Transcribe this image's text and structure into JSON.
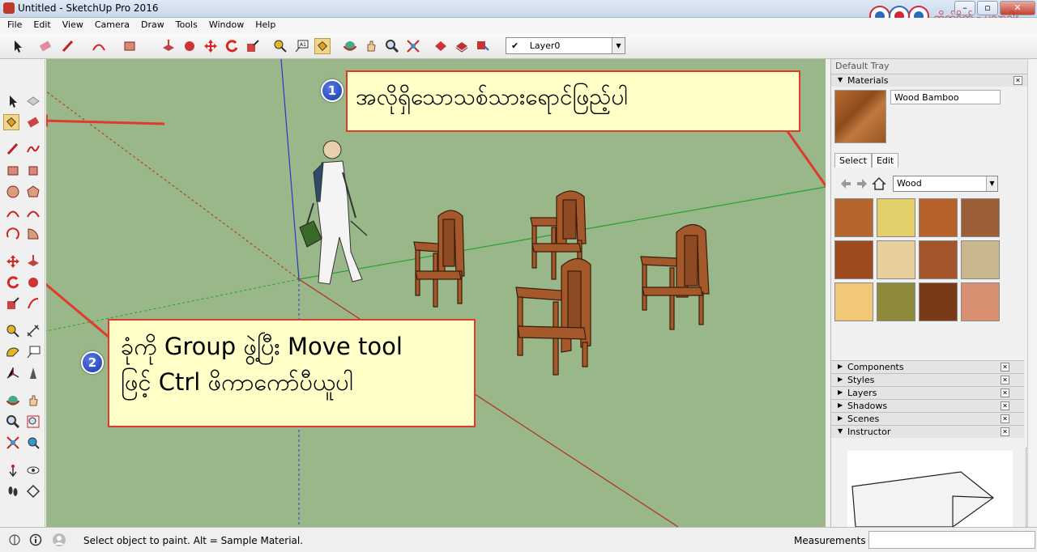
{
  "window": {
    "title": "Untitled - SketchUp Pro 2016",
    "btn_min": "–",
    "btn_max": "▫",
    "btn_close": "✕"
  },
  "logo": {
    "text": "တိုက်ရိုက် - ပညာဒါန"
  },
  "menu": [
    "File",
    "Edit",
    "View",
    "Camera",
    "Draw",
    "Tools",
    "Window",
    "Help"
  ],
  "layer": {
    "check": "✔",
    "name": "Layer0",
    "arrow": "▼"
  },
  "tray": {
    "title": "Default Tray",
    "materials_header": "Materials",
    "material_name": "Wood Bamboo",
    "tab_select": "Select",
    "tab_edit": "Edit",
    "collection": "Wood",
    "panels": [
      "Components",
      "Styles",
      "Layers",
      "Shadows",
      "Scenes",
      "Instructor"
    ]
  },
  "swatch_colors": [
    "#b5662c",
    "#e2cf6a",
    "#b5622a",
    "#9c5e36",
    "#9c4a1e",
    "#e6cf9c",
    "#a4552a",
    "#c9b88e",
    "#f0c878",
    "#8e8a3c",
    "#7a3a18",
    "#d99072"
  ],
  "status": {
    "message": "Select object to paint. Alt = Sample Material.",
    "measurements": "Measurements"
  },
  "callouts": [
    {
      "badge": "1",
      "text": "အလိုရှိသောသစ်သားရောင်ဖြည့်ပါ"
    },
    {
      "badge": "2",
      "line1": "ခုံကို Group ဖွဲ့ပြီး Move tool",
      "line2": "ဖြင့် Ctrl ဖိကာကော်ပီယူပါ"
    }
  ],
  "colors": {
    "accent_red": "#e23a2a",
    "callout_bg": "#ffffc8",
    "ground": "#9ab78a",
    "chair": "#a5582a"
  }
}
